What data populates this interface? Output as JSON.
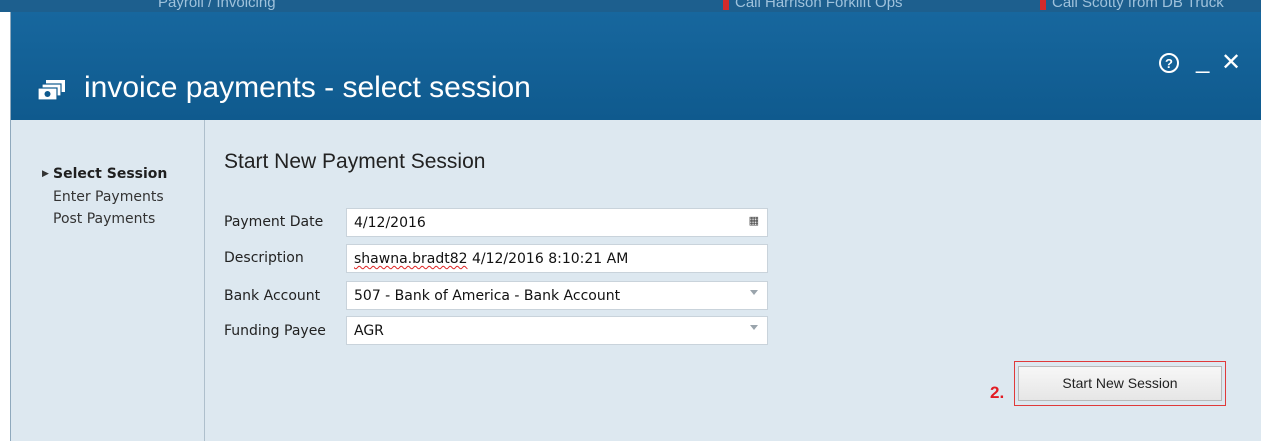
{
  "background_app": {
    "left_text": "Payroll / Invoicing",
    "reminder_1": "Call Harrison Forklift Ops",
    "reminder_2": "Call Scotty from DB Truck"
  },
  "dialog": {
    "title": "invoice payments - select session",
    "help_symbol": "?",
    "minimize_symbol": "_",
    "close_symbol": "✕"
  },
  "nav": {
    "items": [
      {
        "label": "Select Session",
        "active": true
      },
      {
        "label": "Enter Payments",
        "active": false
      },
      {
        "label": "Post Payments",
        "active": false
      }
    ]
  },
  "form": {
    "heading": "Start New Payment Session",
    "payment_date": {
      "label": "Payment Date",
      "value": "4/12/2016"
    },
    "description": {
      "label": "Description",
      "value_user": "shawna.bradt82",
      "value_rest": " 4/12/2016 8:10:21 AM"
    },
    "bank_account": {
      "label": "Bank Account",
      "value": "507 - Bank of America - Bank Account"
    },
    "funding_payee": {
      "label": "Funding Payee",
      "value": "AGR"
    }
  },
  "actions": {
    "step_marker": "2.",
    "start_button_label": "Start New Session"
  },
  "colors": {
    "titlebar": "#17679e",
    "dialog_bg": "#dde8f0",
    "highlight": "#e21b23"
  }
}
